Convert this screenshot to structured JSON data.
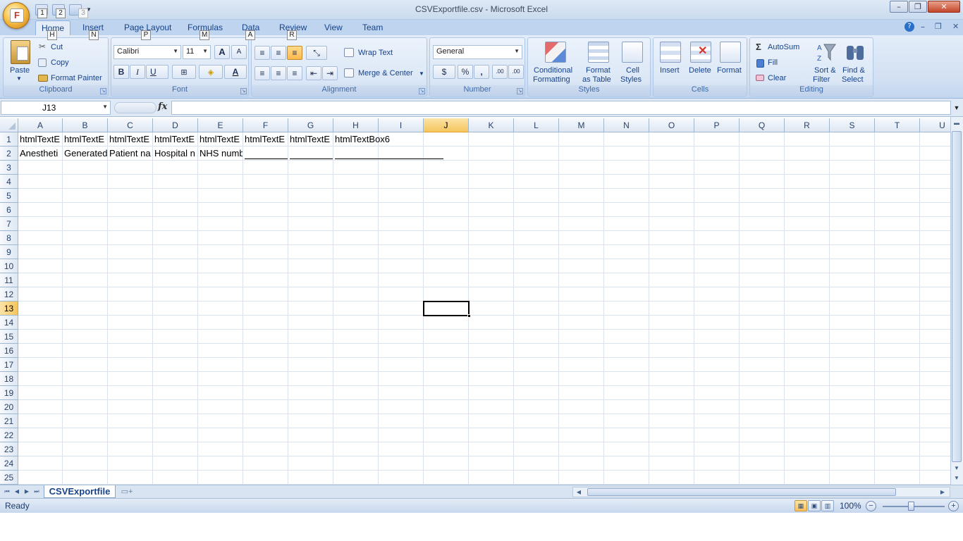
{
  "window": {
    "title": "CSVExportfile.csv - Microsoft Excel",
    "minimize": "–",
    "restore": "❐",
    "close": "✕"
  },
  "office_button": {
    "glyph": "F"
  },
  "quick_access": {
    "keytips": [
      "1",
      "2",
      "3"
    ]
  },
  "tabs": [
    {
      "label": "Home",
      "keytip": "H",
      "active": true
    },
    {
      "label": "Insert",
      "keytip": "N"
    },
    {
      "label": "Page Layout",
      "keytip": "P"
    },
    {
      "label": "Formulas",
      "keytip": "M"
    },
    {
      "label": "Data",
      "keytip": "A"
    },
    {
      "label": "Review",
      "keytip": "R"
    },
    {
      "label": "View"
    },
    {
      "label": "Team"
    }
  ],
  "ribbon_controls": {
    "help": "?",
    "minimize": "–",
    "restore": "❐",
    "close": "✕"
  },
  "ribbon": {
    "clipboard": {
      "label": "Clipboard",
      "paste": "Paste",
      "cut": "Cut",
      "copy": "Copy",
      "format_painter": "Format Painter"
    },
    "font": {
      "label": "Font",
      "font_name": "Calibri",
      "font_size": "11",
      "grow": "A",
      "shrink": "A",
      "bold": "B",
      "italic": "I",
      "underline": "U"
    },
    "alignment": {
      "label": "Alignment",
      "wrap_text": "Wrap Text",
      "merge_center": "Merge & Center"
    },
    "number": {
      "label": "Number",
      "format": "General",
      "percent": "%",
      "comma": ",",
      "inc_decimal": ".00",
      "dec_decimal": ".00"
    },
    "styles": {
      "label": "Styles",
      "conditional_1": "Conditional",
      "conditional_2": "Formatting",
      "table_1": "Format",
      "table_2": "as Table",
      "cell_1": "Cell",
      "cell_2": "Styles"
    },
    "cells": {
      "label": "Cells",
      "insert": "Insert",
      "delete": "Delete",
      "format": "Format"
    },
    "editing": {
      "label": "Editing",
      "autosum": "AutoSum",
      "fill": "Fill",
      "clear": "Clear",
      "sort_1": "Sort &",
      "sort_2": "Filter",
      "find_1": "Find &",
      "find_2": "Select"
    }
  },
  "formula_bar": {
    "name_box": "J13",
    "fx": "fx",
    "formula": ""
  },
  "grid": {
    "columns": [
      "A",
      "B",
      "C",
      "D",
      "E",
      "F",
      "G",
      "H",
      "I",
      "J",
      "K",
      "L",
      "M",
      "N",
      "O",
      "P",
      "Q",
      "R",
      "S",
      "T",
      "U"
    ],
    "selected_column": "J",
    "rows": [
      "1",
      "2",
      "3",
      "4",
      "5",
      "6",
      "7",
      "8",
      "9",
      "10",
      "11",
      "12",
      "13",
      "14",
      "15",
      "16",
      "17",
      "18",
      "19",
      "20",
      "21",
      "22",
      "23",
      "24",
      "25"
    ],
    "selected_row": "13",
    "row1": [
      "htmlTextE",
      "htmlTextE",
      "htmlTextE",
      "htmlTextE",
      "htmlTextE",
      "htmlTextE",
      "htmlTextE",
      "htmlTextBox6"
    ],
    "row2": [
      "Anestheti",
      "Generated",
      "Patient na",
      "Hospital n",
      "NHS numb"
    ]
  },
  "sheets": {
    "active": "CSVExportfile"
  },
  "status": {
    "text": "Ready",
    "zoom": "100%",
    "zoom_out": "−",
    "zoom_in": "+"
  }
}
